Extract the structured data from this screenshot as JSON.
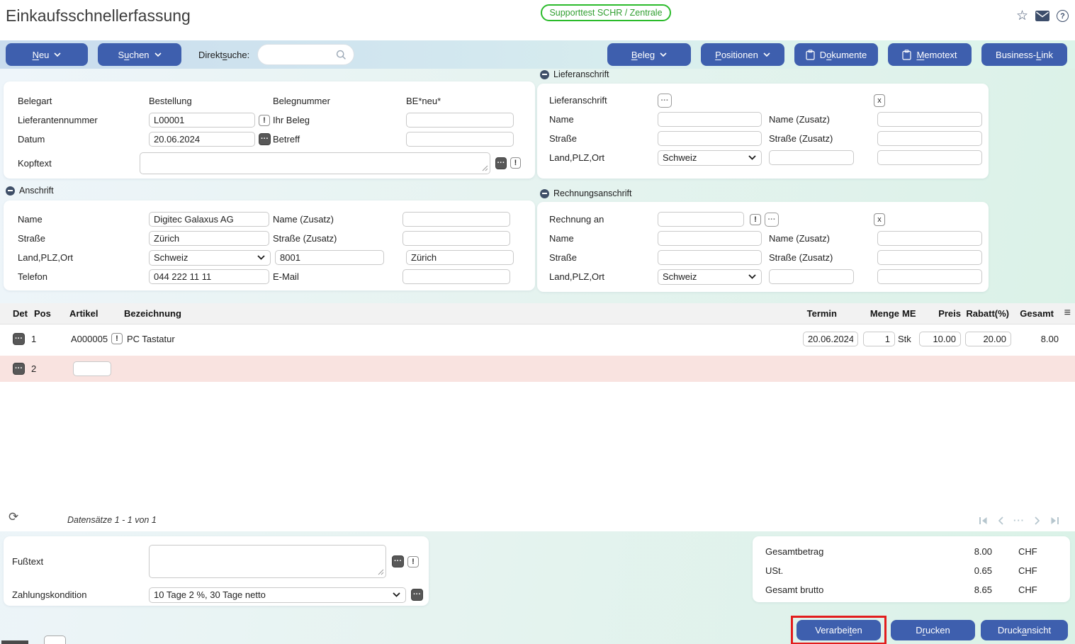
{
  "header": {
    "title": "Einkaufsschnellerfassung",
    "environment_badge": "Supporttest SCHR / Zentrale"
  },
  "toolbar": {
    "neu": {
      "pre": "",
      "key": "N",
      "post": "eu"
    },
    "suchen": {
      "pre": "S",
      "key": "u",
      "post": "chen"
    },
    "direktsuche": {
      "pre": "Direkt",
      "key": "s",
      "post": "uche:"
    },
    "beleg": {
      "pre": "",
      "key": "B",
      "post": "eleg"
    },
    "positionen": {
      "pre": "",
      "key": "P",
      "post": "ositionen"
    },
    "dokumente": {
      "pre": "D",
      "key": "o",
      "post": "kumente"
    },
    "memotext": {
      "pre": "",
      "key": "M",
      "post": "emotext"
    },
    "business_link": {
      "pre": "Business-",
      "key": "L",
      "post": "ink"
    }
  },
  "beleg_panel": {
    "belegart_label": "Belegart",
    "belegart_value": "Bestellung",
    "belegnummer_label": "Belegnummer",
    "belegnummer_value": "BE*neu*",
    "lieferantennummer_label": "Lieferantennummer",
    "lieferantennummer_value": "L00001",
    "ihr_beleg_label": "Ihr Beleg",
    "datum_label": "Datum",
    "datum_value": "20.06.2024",
    "betreff_label": "Betreff",
    "kopftext_label": "Kopftext"
  },
  "anschrift": {
    "section_title": "Anschrift",
    "name_label": "Name",
    "name_value": "Digitec Galaxus AG",
    "name_zusatz_label": "Name (Zusatz)",
    "strasse_label": "Straße",
    "strasse_value": "Zürich",
    "strasse_zusatz_label": "Straße (Zusatz)",
    "land_plz_ort_label": "Land,PLZ,Ort",
    "land_value": "Schweiz",
    "plz_value": "8001",
    "ort_value": "Zürich",
    "telefon_label": "Telefon",
    "telefon_value": "044 222 11 11",
    "email_label": "E-Mail"
  },
  "lieferanschrift": {
    "section_title": "Lieferanschrift",
    "row_label": "Lieferanschrift",
    "name_label": "Name",
    "name_zusatz_label": "Name (Zusatz)",
    "strasse_label": "Straße",
    "strasse_zusatz_label": "Straße (Zusatz)",
    "land_plz_ort_label": "Land,PLZ,Ort",
    "land_value": "Schweiz"
  },
  "rechnungsanschrift": {
    "section_title": "Rechnungsanschrift",
    "row_label": "Rechnung an",
    "name_label": "Name",
    "name_zusatz_label": "Name (Zusatz)",
    "strasse_label": "Straße",
    "strasse_zusatz_label": "Straße (Zusatz)",
    "land_plz_ort_label": "Land,PLZ,Ort",
    "land_value": "Schweiz"
  },
  "positions_table": {
    "headers": {
      "det": "Det",
      "pos": "Pos",
      "artikel": "Artikel",
      "bezeichnung": "Bezeichnung",
      "termin": "Termin",
      "menge": "Menge",
      "me": "ME",
      "preis": "Preis",
      "rabatt": "Rabatt(%)",
      "gesamt": "Gesamt"
    },
    "rows": [
      {
        "pos": "1",
        "artikel": "A000005",
        "bezeichnung": "PC Tastatur",
        "termin": "20.06.2024",
        "menge": "1",
        "me": "Stk",
        "preis": "10.00",
        "rabatt": "20.00",
        "gesamt": "8.00"
      },
      {
        "pos": "2",
        "artikel": ""
      }
    ],
    "record_info": "Datensätze 1 - 1 von 1"
  },
  "footer_panel": {
    "fusstext_label": "Fußtext",
    "zahlungskondition_label": "Zahlungskondition",
    "zahlungskondition_value": "10 Tage 2 %, 30 Tage netto"
  },
  "totals": {
    "gesamtbetrag": {
      "label": "Gesamtbetrag",
      "value": "8.00",
      "currency": "CHF"
    },
    "ust": {
      "label": "USt.",
      "value": "0.65",
      "currency": "CHF"
    },
    "gesamt_brutto": {
      "label": "Gesamt brutto",
      "value": "8.65",
      "currency": "CHF"
    }
  },
  "actions": {
    "verarbeiten": {
      "pre": "Verarbei",
      "key": "t",
      "post": "en"
    },
    "drucken": {
      "pre": "D",
      "key": "r",
      "post": "ucken"
    },
    "druckansicht": {
      "pre": "Druck",
      "key": "a",
      "post": "nsicht"
    }
  },
  "icons": {
    "ellipsis": "···",
    "warning": "!",
    "clear": "x",
    "star": "☆",
    "help": "?",
    "refresh": "⟳",
    "hamburger": "≡",
    "pagination_ellipsis": "···"
  },
  "colors": {
    "primary_button": "#3e5fae",
    "badge_green": "#2bbb2b",
    "row_highlight": "#f9e3e0",
    "annotation_red": "#e21d1d"
  }
}
